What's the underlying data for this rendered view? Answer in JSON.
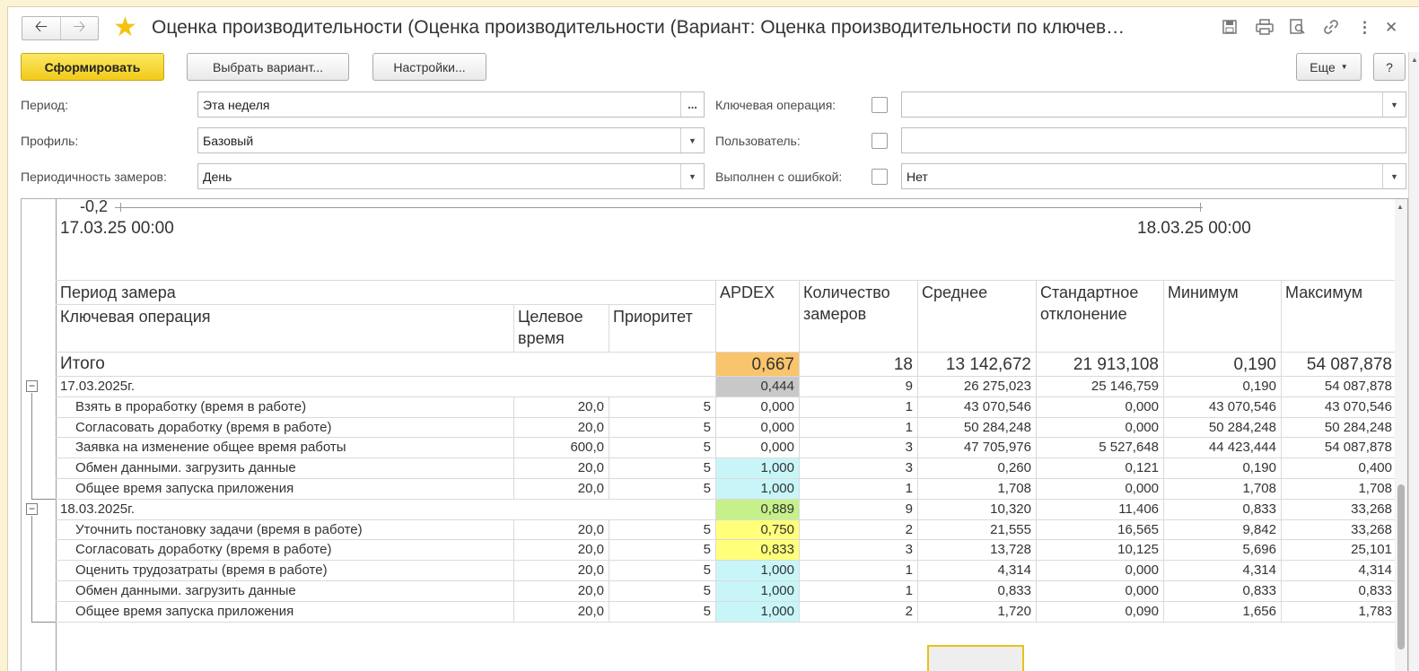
{
  "window": {
    "title": "Оценка производительности (Оценка производительности (Вариант: Оценка производительности по ключев…"
  },
  "toolbar": {
    "generate": "Сформировать",
    "choose_variant": "Выбрать вариант...",
    "settings": "Настройки...",
    "more": "Еще",
    "help": "?"
  },
  "form": {
    "period_label": "Период:",
    "period_value": "Эта неделя",
    "period_btn": "...",
    "profile_label": "Профиль:",
    "profile_value": "Базовый",
    "frequency_label": "Периодичность замеров:",
    "frequency_value": "День",
    "key_op_label": "Ключевая операция:",
    "key_op_value": "",
    "user_label": "Пользователь:",
    "user_value": "",
    "error_label": "Выполнен с ошибкой:",
    "error_value": "Нет"
  },
  "chart": {
    "y_tick": "-0,2",
    "x_start": "17.03.25 00:00",
    "x_end": "18.03.25 00:00"
  },
  "table": {
    "headers": {
      "period": "Период замера",
      "key_operation": "Ключевая операция",
      "target_time": "Целевое время",
      "priority": "Приоритет",
      "apdex": "APDEX",
      "count": "Количество замеров",
      "average": "Среднее",
      "std_dev": "Стандартное отклонение",
      "minimum": "Минимум",
      "maximum": "Максимум"
    },
    "total": {
      "label": "Итого",
      "apdex": "0,667",
      "count": "18",
      "average": "13 142,672",
      "std_dev": "21 913,108",
      "min": "0,190",
      "max": "54 087,878"
    },
    "groups": [
      {
        "date": "17.03.2025г.",
        "apdex": "0,444",
        "count": "9",
        "average": "26 275,023",
        "std_dev": "25 146,759",
        "min": "0,190",
        "max": "54 087,878",
        "rows": [
          {
            "name": "Взять в проработку (время в работе)",
            "target": "20,0",
            "priority": "5",
            "apdex": "0,000",
            "count": "1",
            "average": "43 070,546",
            "std_dev": "0,000",
            "min": "43 070,546",
            "max": "43 070,546"
          },
          {
            "name": "Согласовать доработку (время в работе)",
            "target": "20,0",
            "priority": "5",
            "apdex": "0,000",
            "count": "1",
            "average": "50 284,248",
            "std_dev": "0,000",
            "min": "50 284,248",
            "max": "50 284,248"
          },
          {
            "name": "Заявка на изменение общее время работы",
            "target": "600,0",
            "priority": "5",
            "apdex": "0,000",
            "count": "3",
            "average": "47 705,976",
            "std_dev": "5 527,648",
            "min": "44 423,444",
            "max": "54 087,878"
          },
          {
            "name": "Обмен данными. загрузить данные",
            "target": "20,0",
            "priority": "5",
            "apdex": "1,000",
            "count": "3",
            "average": "0,260",
            "std_dev": "0,121",
            "min": "0,190",
            "max": "0,400"
          },
          {
            "name": "Общее время запуска приложения",
            "target": "20,0",
            "priority": "5",
            "apdex": "1,000",
            "count": "1",
            "average": "1,708",
            "std_dev": "0,000",
            "min": "1,708",
            "max": "1,708"
          }
        ]
      },
      {
        "date": "18.03.2025г.",
        "apdex": "0,889",
        "count": "9",
        "average": "10,320",
        "std_dev": "11,406",
        "min": "0,833",
        "max": "33,268",
        "rows": [
          {
            "name": "Уточнить постановку задачи (время в работе)",
            "target": "20,0",
            "priority": "5",
            "apdex": "0,750",
            "count": "2",
            "average": "21,555",
            "std_dev": "16,565",
            "min": "9,842",
            "max": "33,268"
          },
          {
            "name": "Согласовать доработку (время в работе)",
            "target": "20,0",
            "priority": "5",
            "apdex": "0,833",
            "count": "3",
            "average": "13,728",
            "std_dev": "10,125",
            "min": "5,696",
            "max": "25,101"
          },
          {
            "name": "Оценить трудозатраты (время в работе)",
            "target": "20,0",
            "priority": "5",
            "apdex": "1,000",
            "count": "1",
            "average": "4,314",
            "std_dev": "0,000",
            "min": "4,314",
            "max": "4,314"
          },
          {
            "name": "Обмен данными. загрузить данные",
            "target": "20,0",
            "priority": "5",
            "apdex": "1,000",
            "count": "1",
            "average": "0,833",
            "std_dev": "0,000",
            "min": "0,833",
            "max": "0,833"
          },
          {
            "name": "Общее время запуска приложения",
            "target": "20,0",
            "priority": "5",
            "apdex": "1,000",
            "count": "2",
            "average": "1,720",
            "std_dev": "0,090",
            "min": "1,656",
            "max": "1,783"
          }
        ]
      }
    ]
  },
  "colors": {
    "apdex_total": "#f9c46b",
    "apdex_group_low": "#c8c8c8",
    "apdex_group_good": "#c6f08a",
    "apdex_zero": "#ffffff",
    "apdex_excellent": "#c8f6f8",
    "apdex_fair": "#ffff7a"
  }
}
